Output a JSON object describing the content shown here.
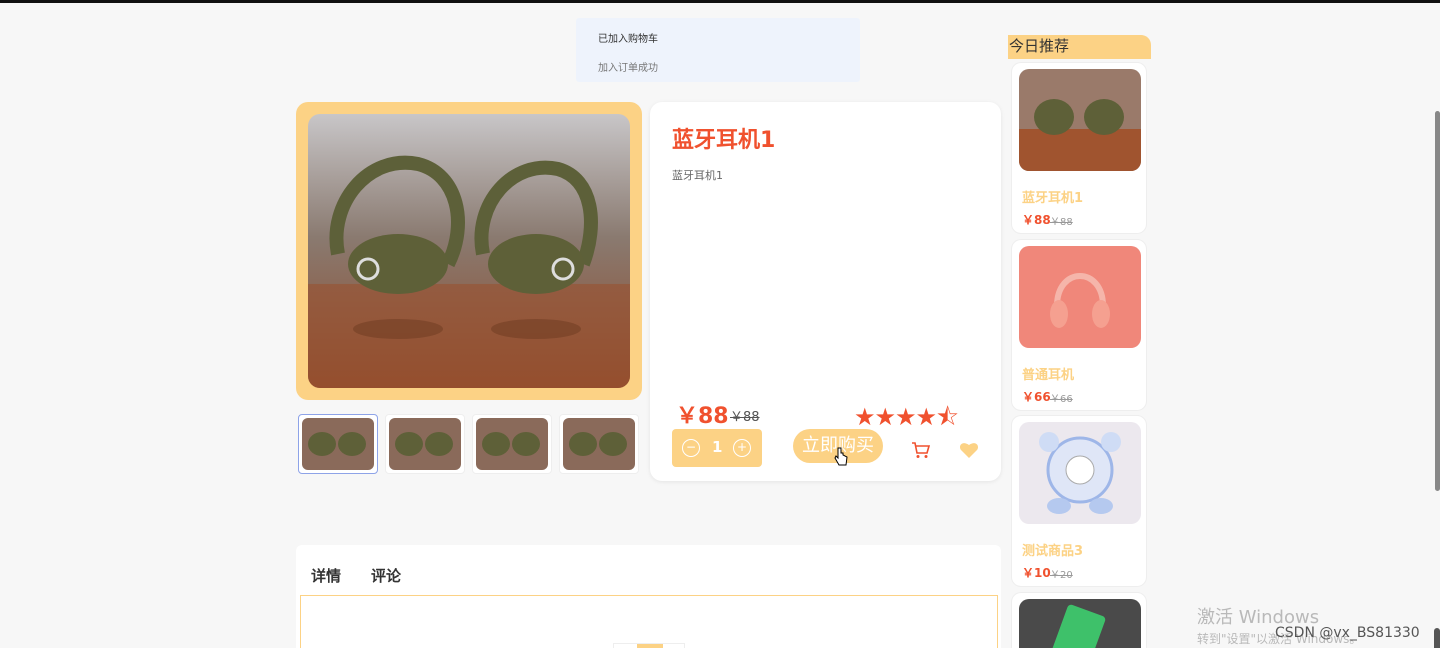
{
  "toast": {
    "line1": "已加入购物车",
    "line2": "加入订单成功"
  },
  "product": {
    "title": "蓝牙耳机1",
    "description": "蓝牙耳机1",
    "price": "￥88",
    "old_price": "￥88",
    "rating": 4.5,
    "stars_display": "★★★★⯪",
    "quantity": "1",
    "buy_label": "立即购买",
    "image": "beats-earbuds-photo"
  },
  "thumbnails": [
    "beats-earbuds-photo",
    "beats-earbuds-photo",
    "beats-earbuds-photo",
    "beats-earbuds-photo"
  ],
  "tabs": [
    {
      "label": "详情"
    },
    {
      "label": "评论"
    }
  ],
  "recommend": {
    "header": "今日推荐",
    "items": [
      {
        "name": "蓝牙耳机1",
        "price": "￥88",
        "old_price": "￥88",
        "image": "beats-earbuds-photo"
      },
      {
        "name": "普通耳机",
        "price": "￥66",
        "old_price": "￥66",
        "image": "red-headphones-photo"
      },
      {
        "name": "测试商品3",
        "price": "￥10",
        "old_price": "￥20",
        "image": "desk-fan-photo"
      }
    ]
  },
  "watermark": {
    "line1": "激活 Windows",
    "line2": "转到\"设置\"以激活 Windows。",
    "csdn": "CSDN @vx_BS81330"
  },
  "colors": {
    "accent": "#fcd285",
    "price": "#f0512e"
  }
}
